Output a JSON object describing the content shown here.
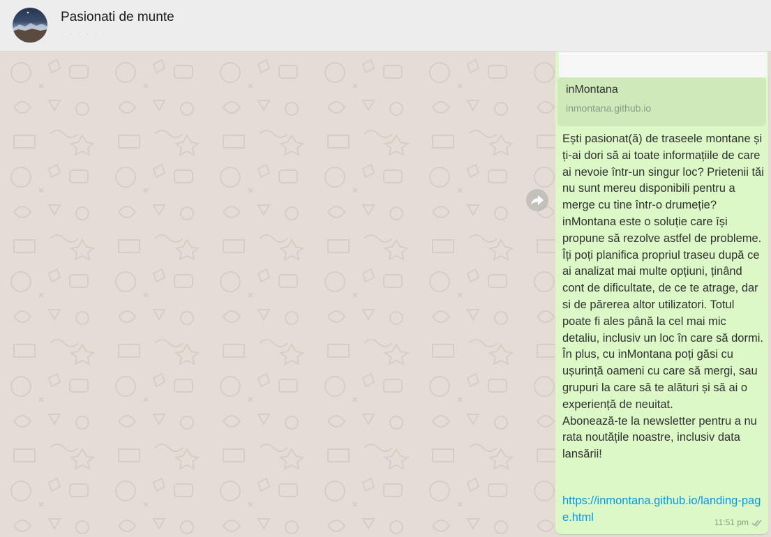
{
  "header": {
    "title": "Pasionati de munte",
    "subtitle": "· · · · · ·"
  },
  "message": {
    "preview": {
      "title": "inMontana",
      "url": "inmontana.github.io"
    },
    "text": "Ești pasionat(ă) de traseele montane și ți-ai dori să ai toate informațiile de care ai nevoie într-un singur loc? Prietenii tăi nu sunt mereu disponibili pentru a merge cu tine într-o drumeție?\ninMontana este o soluție care își propune să rezolve astfel de probleme. Îți poți planifica propriul traseu după ce ai analizat mai multe opțiuni, ținând cont de dificultate, de ce te atrage, dar si de părerea altor utilizatori. Totul poate fi ales până la cel mai mic detaliu, inclusiv un loc în care să dormi. În plus, cu inMontana poți găsi cu ușurință oameni cu care să mergi, sau grupuri la care să te alături și să ai o experiență de neuitat.\nAbonează-te la newsletter pentru a nu rata noutățile noastre, inclusiv data lansării!",
    "link": "https://inmontana.github.io/landing-page.html",
    "time": "11:51 pm",
    "status_icon": "double-check-icon"
  },
  "colors": {
    "chat_background": "#e5ddd5",
    "bubble_outgoing": "#dcf8c6",
    "link": "#039be5",
    "header_background": "#ededed"
  }
}
